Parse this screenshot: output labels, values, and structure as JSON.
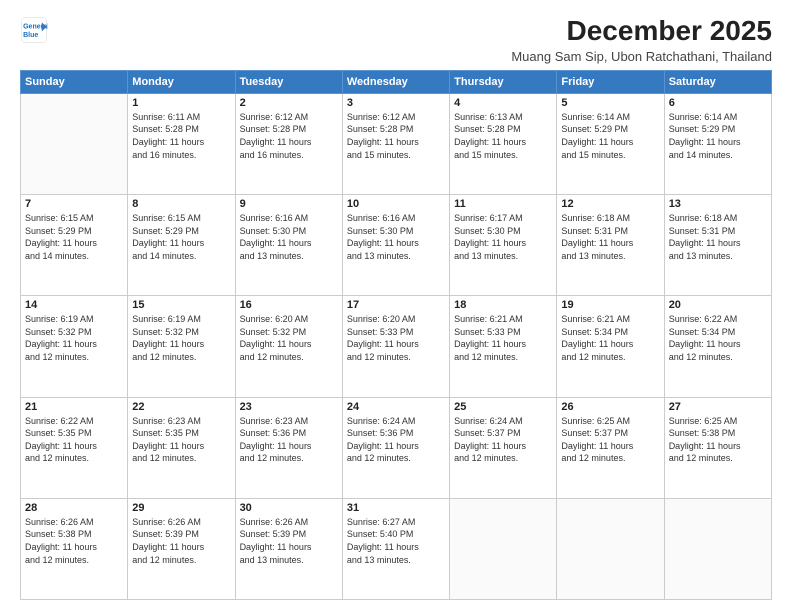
{
  "header": {
    "logo_line1": "General",
    "logo_line2": "Blue",
    "title": "December 2025",
    "subtitle": "Muang Sam Sip, Ubon Ratchathani, Thailand"
  },
  "columns": [
    "Sunday",
    "Monday",
    "Tuesday",
    "Wednesday",
    "Thursday",
    "Friday",
    "Saturday"
  ],
  "weeks": [
    [
      {
        "day": "",
        "info": ""
      },
      {
        "day": "1",
        "info": "Sunrise: 6:11 AM\nSunset: 5:28 PM\nDaylight: 11 hours\nand 16 minutes."
      },
      {
        "day": "2",
        "info": "Sunrise: 6:12 AM\nSunset: 5:28 PM\nDaylight: 11 hours\nand 16 minutes."
      },
      {
        "day": "3",
        "info": "Sunrise: 6:12 AM\nSunset: 5:28 PM\nDaylight: 11 hours\nand 15 minutes."
      },
      {
        "day": "4",
        "info": "Sunrise: 6:13 AM\nSunset: 5:28 PM\nDaylight: 11 hours\nand 15 minutes."
      },
      {
        "day": "5",
        "info": "Sunrise: 6:14 AM\nSunset: 5:29 PM\nDaylight: 11 hours\nand 15 minutes."
      },
      {
        "day": "6",
        "info": "Sunrise: 6:14 AM\nSunset: 5:29 PM\nDaylight: 11 hours\nand 14 minutes."
      }
    ],
    [
      {
        "day": "7",
        "info": "Sunrise: 6:15 AM\nSunset: 5:29 PM\nDaylight: 11 hours\nand 14 minutes."
      },
      {
        "day": "8",
        "info": "Sunrise: 6:15 AM\nSunset: 5:29 PM\nDaylight: 11 hours\nand 14 minutes."
      },
      {
        "day": "9",
        "info": "Sunrise: 6:16 AM\nSunset: 5:30 PM\nDaylight: 11 hours\nand 13 minutes."
      },
      {
        "day": "10",
        "info": "Sunrise: 6:16 AM\nSunset: 5:30 PM\nDaylight: 11 hours\nand 13 minutes."
      },
      {
        "day": "11",
        "info": "Sunrise: 6:17 AM\nSunset: 5:30 PM\nDaylight: 11 hours\nand 13 minutes."
      },
      {
        "day": "12",
        "info": "Sunrise: 6:18 AM\nSunset: 5:31 PM\nDaylight: 11 hours\nand 13 minutes."
      },
      {
        "day": "13",
        "info": "Sunrise: 6:18 AM\nSunset: 5:31 PM\nDaylight: 11 hours\nand 13 minutes."
      }
    ],
    [
      {
        "day": "14",
        "info": "Sunrise: 6:19 AM\nSunset: 5:32 PM\nDaylight: 11 hours\nand 12 minutes."
      },
      {
        "day": "15",
        "info": "Sunrise: 6:19 AM\nSunset: 5:32 PM\nDaylight: 11 hours\nand 12 minutes."
      },
      {
        "day": "16",
        "info": "Sunrise: 6:20 AM\nSunset: 5:32 PM\nDaylight: 11 hours\nand 12 minutes."
      },
      {
        "day": "17",
        "info": "Sunrise: 6:20 AM\nSunset: 5:33 PM\nDaylight: 11 hours\nand 12 minutes."
      },
      {
        "day": "18",
        "info": "Sunrise: 6:21 AM\nSunset: 5:33 PM\nDaylight: 11 hours\nand 12 minutes."
      },
      {
        "day": "19",
        "info": "Sunrise: 6:21 AM\nSunset: 5:34 PM\nDaylight: 11 hours\nand 12 minutes."
      },
      {
        "day": "20",
        "info": "Sunrise: 6:22 AM\nSunset: 5:34 PM\nDaylight: 11 hours\nand 12 minutes."
      }
    ],
    [
      {
        "day": "21",
        "info": "Sunrise: 6:22 AM\nSunset: 5:35 PM\nDaylight: 11 hours\nand 12 minutes."
      },
      {
        "day": "22",
        "info": "Sunrise: 6:23 AM\nSunset: 5:35 PM\nDaylight: 11 hours\nand 12 minutes."
      },
      {
        "day": "23",
        "info": "Sunrise: 6:23 AM\nSunset: 5:36 PM\nDaylight: 11 hours\nand 12 minutes."
      },
      {
        "day": "24",
        "info": "Sunrise: 6:24 AM\nSunset: 5:36 PM\nDaylight: 11 hours\nand 12 minutes."
      },
      {
        "day": "25",
        "info": "Sunrise: 6:24 AM\nSunset: 5:37 PM\nDaylight: 11 hours\nand 12 minutes."
      },
      {
        "day": "26",
        "info": "Sunrise: 6:25 AM\nSunset: 5:37 PM\nDaylight: 11 hours\nand 12 minutes."
      },
      {
        "day": "27",
        "info": "Sunrise: 6:25 AM\nSunset: 5:38 PM\nDaylight: 11 hours\nand 12 minutes."
      }
    ],
    [
      {
        "day": "28",
        "info": "Sunrise: 6:26 AM\nSunset: 5:38 PM\nDaylight: 11 hours\nand 12 minutes."
      },
      {
        "day": "29",
        "info": "Sunrise: 6:26 AM\nSunset: 5:39 PM\nDaylight: 11 hours\nand 12 minutes."
      },
      {
        "day": "30",
        "info": "Sunrise: 6:26 AM\nSunset: 5:39 PM\nDaylight: 11 hours\nand 13 minutes."
      },
      {
        "day": "31",
        "info": "Sunrise: 6:27 AM\nSunset: 5:40 PM\nDaylight: 11 hours\nand 13 minutes."
      },
      {
        "day": "",
        "info": ""
      },
      {
        "day": "",
        "info": ""
      },
      {
        "day": "",
        "info": ""
      }
    ]
  ]
}
